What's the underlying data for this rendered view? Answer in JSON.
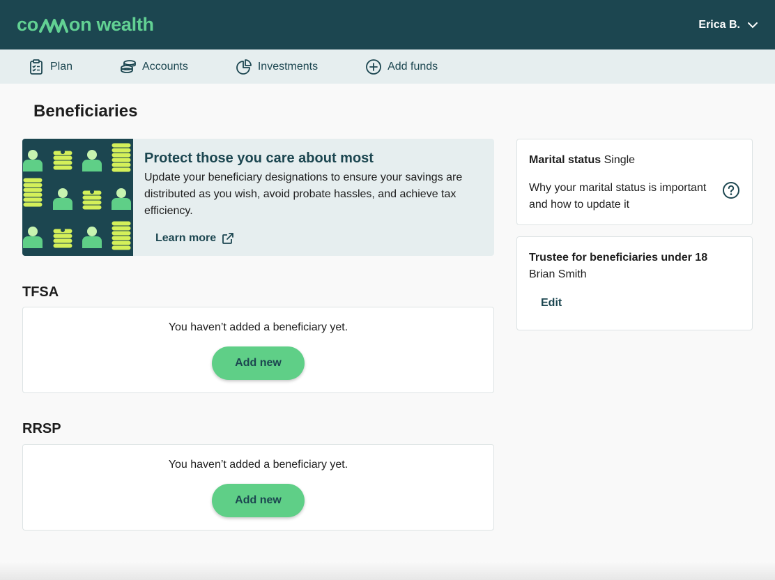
{
  "header": {
    "logo_left": "co",
    "logo_right": "on wealth",
    "user_name": "Erica B.",
    "colors": {
      "brand_dark": "#1c4650",
      "brand_green": "#62d193"
    }
  },
  "nav": {
    "items": [
      {
        "label": "Plan",
        "icon": "clipboard-icon"
      },
      {
        "label": "Accounts",
        "icon": "coin-stack-icon"
      },
      {
        "label": "Investments",
        "icon": "pie-chart-icon"
      },
      {
        "label": "Add funds",
        "icon": "plus-circle-icon"
      }
    ]
  },
  "page": {
    "title": "Beneficiaries"
  },
  "promo": {
    "title": "Protect those you care about most",
    "text": "Update your beneficiary designations to ensure your savings are distributed as you wish, avoid probate hassles, and achieve tax efficiency.",
    "link_label": "Learn more",
    "link_icon": "external-link-icon"
  },
  "accounts": [
    {
      "name": "TFSA",
      "empty_text": "You haven’t added a beneficiary yet.",
      "button_label": "Add new"
    },
    {
      "name": "RRSP",
      "empty_text": "You haven’t added a beneficiary yet.",
      "button_label": "Add new"
    }
  ],
  "marital": {
    "label": "Marital status",
    "value": "Single",
    "help_text": "Why your marital status is important and how to update it",
    "help_icon": "question-circle-icon"
  },
  "trustee": {
    "label": "Trustee for beneficiaries under 18",
    "name": "Brian Smith",
    "edit_label": "Edit"
  }
}
